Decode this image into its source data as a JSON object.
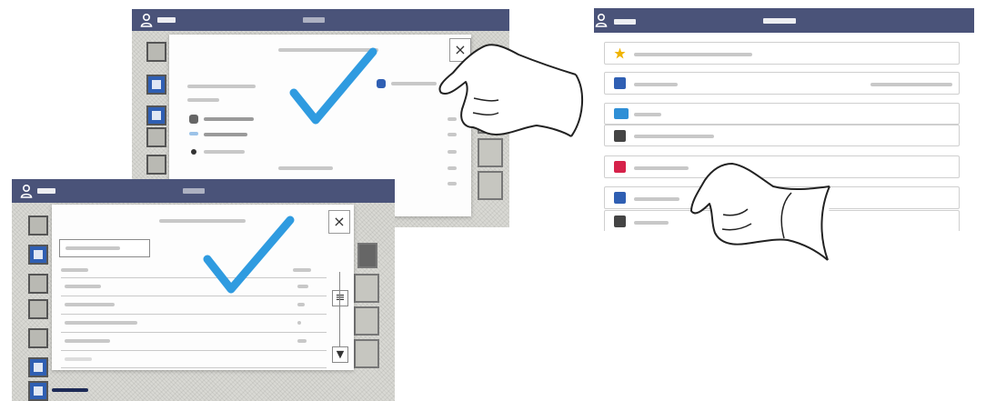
{
  "screenshot_top": {
    "has_close": true,
    "close_glyph": "×",
    "checkmark_color": "#2f9be0"
  },
  "screenshot_bottom": {
    "close_glyph": "×",
    "scroll_glyph": "▼",
    "menu_glyph": "≡",
    "checkmark_color": "#2f9be0"
  },
  "app_panel": {
    "bar_color": "#4a5379",
    "rows": [
      {
        "icon": "star-icon",
        "color": "#f0b400"
      },
      {
        "icon": "address-book-icon",
        "color": "#2f5fb3"
      },
      {
        "icon": "copy-icon",
        "color": "#2f8fd6"
      },
      {
        "icon": "scan-icon",
        "color": "#444444"
      },
      {
        "icon": "fax-icon",
        "color": "#d6224a"
      },
      {
        "icon": "trash-icon",
        "color": "#2f5fb3"
      },
      {
        "icon": "print-icon",
        "color": "#444444"
      }
    ]
  },
  "colors": {
    "topbar": "#4a5379",
    "check": "#2f9be0",
    "tile_blue": "#2f5fb3"
  }
}
